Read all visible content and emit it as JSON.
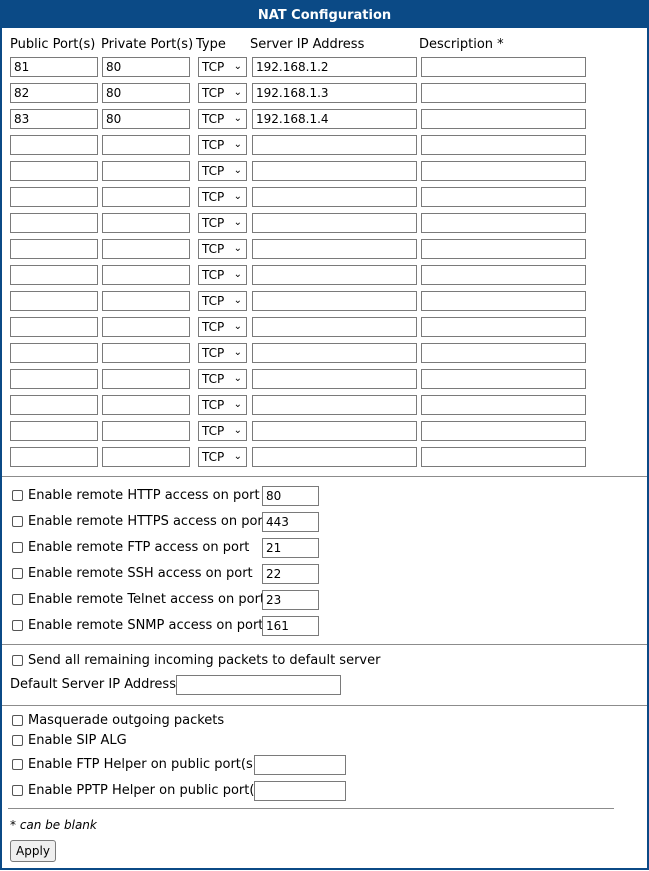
{
  "title": "NAT Configuration",
  "columns": {
    "public_port": "Public Port(s)",
    "private_port": "Private Port(s)",
    "type": "Type",
    "server_ip": "Server IP Address",
    "description": "Description *"
  },
  "rules": [
    {
      "public": "81",
      "private": "80",
      "type": "TCP",
      "ip": "192.168.1.2",
      "desc": ""
    },
    {
      "public": "82",
      "private": "80",
      "type": "TCP",
      "ip": "192.168.1.3",
      "desc": ""
    },
    {
      "public": "83",
      "private": "80",
      "type": "TCP",
      "ip": "192.168.1.4",
      "desc": ""
    },
    {
      "public": "",
      "private": "",
      "type": "TCP",
      "ip": "",
      "desc": ""
    },
    {
      "public": "",
      "private": "",
      "type": "TCP",
      "ip": "",
      "desc": ""
    },
    {
      "public": "",
      "private": "",
      "type": "TCP",
      "ip": "",
      "desc": ""
    },
    {
      "public": "",
      "private": "",
      "type": "TCP",
      "ip": "",
      "desc": ""
    },
    {
      "public": "",
      "private": "",
      "type": "TCP",
      "ip": "",
      "desc": ""
    },
    {
      "public": "",
      "private": "",
      "type": "TCP",
      "ip": "",
      "desc": ""
    },
    {
      "public": "",
      "private": "",
      "type": "TCP",
      "ip": "",
      "desc": ""
    },
    {
      "public": "",
      "private": "",
      "type": "TCP",
      "ip": "",
      "desc": ""
    },
    {
      "public": "",
      "private": "",
      "type": "TCP",
      "ip": "",
      "desc": ""
    },
    {
      "public": "",
      "private": "",
      "type": "TCP",
      "ip": "",
      "desc": ""
    },
    {
      "public": "",
      "private": "",
      "type": "TCP",
      "ip": "",
      "desc": ""
    },
    {
      "public": "",
      "private": "",
      "type": "TCP",
      "ip": "",
      "desc": ""
    },
    {
      "public": "",
      "private": "",
      "type": "TCP",
      "ip": "",
      "desc": ""
    }
  ],
  "remote_access": [
    {
      "label": "Enable remote HTTP access on port",
      "port": "80",
      "checked": false
    },
    {
      "label": "Enable remote HTTPS access on port",
      "port": "443",
      "checked": false
    },
    {
      "label": "Enable remote FTP access on port",
      "port": "21",
      "checked": false
    },
    {
      "label": "Enable remote SSH access on port",
      "port": "22",
      "checked": false
    },
    {
      "label": "Enable remote Telnet access on port",
      "port": "23",
      "checked": false
    },
    {
      "label": "Enable remote SNMP access on port",
      "port": "161",
      "checked": false
    }
  ],
  "default_server": {
    "send_label": "Send all remaining incoming packets to default server",
    "checked": false,
    "ip_label": "Default Server IP Address",
    "ip_value": ""
  },
  "options": {
    "masquerade_label": "Masquerade outgoing packets",
    "sip_label": "Enable SIP ALG",
    "ftp_helper_label": "Enable FTP Helper on public port(s)",
    "ftp_helper_value": "",
    "pptp_helper_label": "Enable PPTP Helper on public port(s)",
    "pptp_helper_value": ""
  },
  "note": "* can be blank",
  "apply_label": "Apply",
  "colors": {
    "title_bar": "#0b4a86",
    "title_text": "#ffffff"
  }
}
